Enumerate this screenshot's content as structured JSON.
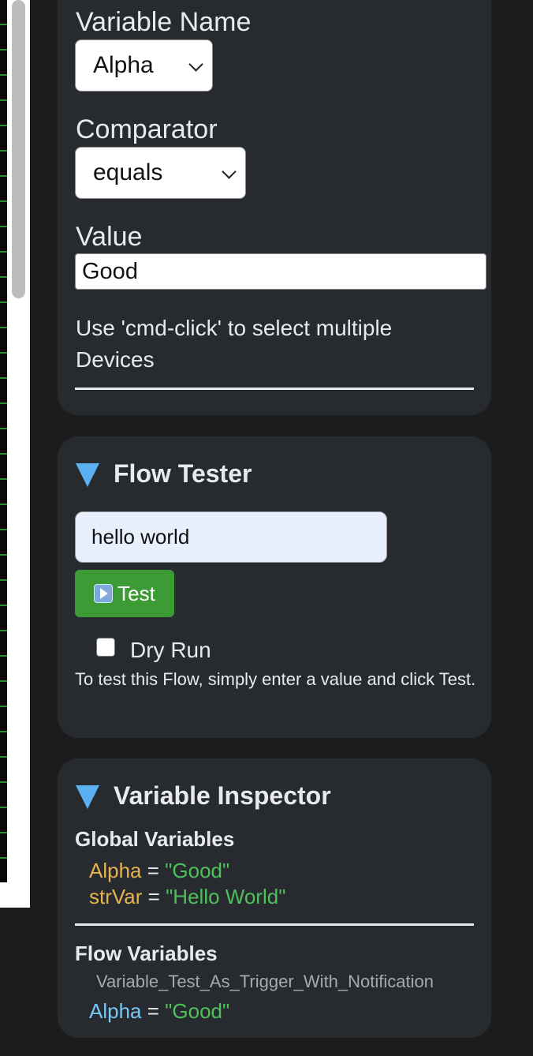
{
  "condition_panel": {
    "variable_name_label": "Variable Name",
    "variable_name_selected": "Alpha",
    "comparator_label": "Comparator",
    "comparator_selected": "equals",
    "value_label": "Value",
    "value_input": "Good",
    "hint": "Use 'cmd-click' to select multiple Devices"
  },
  "flow_tester": {
    "title": "Flow Tester",
    "input_value": "hello world",
    "test_button_label": "Test",
    "dry_run_label": "Dry Run",
    "dry_run_checked": false,
    "help_text": "To test this Flow, simply enter a value and click Test."
  },
  "variable_inspector": {
    "title": "Variable Inspector",
    "global_title": "Global Variables",
    "global_vars": [
      {
        "name": "Alpha",
        "value": "\"Good\""
      },
      {
        "name": "strVar",
        "value": "\"Hello World\""
      }
    ],
    "flow_title": "Flow Variables",
    "flow_name": "Variable_Test_As_Trigger_With_Notification",
    "flow_vars": [
      {
        "name": "Alpha",
        "value": "\"Good\""
      }
    ],
    "equals_sign": "="
  },
  "colors": {
    "panel_bg": "#272a2e",
    "page_bg": "#1c1c1c",
    "test_button": "#3d9b35",
    "triangle_accent": "#5ab0f0",
    "global_var_name": "#e6b450",
    "flow_var_name": "#79c7f5",
    "var_value": "#4fc15b"
  },
  "icons": {
    "section_toggle": "triangle-down-icon",
    "test_button": "play-icon",
    "select_arrow": "chevron-down-icon"
  }
}
